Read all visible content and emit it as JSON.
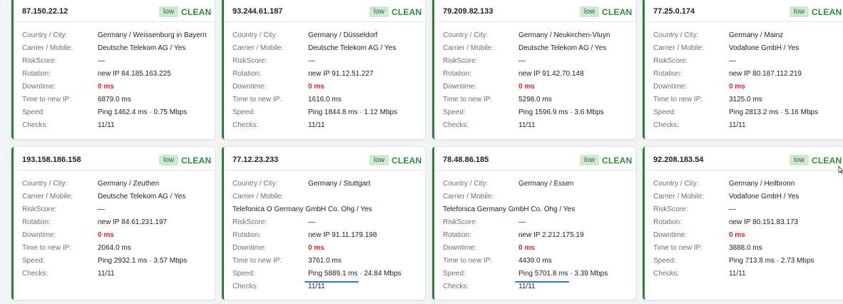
{
  "labels": {
    "country": "Country / City:",
    "carrier": "Carrier / Mobile:",
    "risk": "RiskScore:",
    "rotation": "Rotation:",
    "downtime": "Downtime:",
    "time_new_ip": "Time to new IP:",
    "speed": "Speed:",
    "checks": "Checks:"
  },
  "badge_label": "low",
  "status_label": "CLEAN",
  "colors": {
    "accent": "#2f7d3f",
    "clean": "#2f8a3e",
    "badge_bg": "#cfe8d3",
    "downtime": "#d62828",
    "underline": "#2f73d9"
  },
  "cards": [
    {
      "ip": "87.150.22.12",
      "country": "Germany / Weissenburg in Bayern",
      "carrier": "Deutsche Telekom AG / Yes",
      "risk": "—",
      "rotation": "new IP 84.185.163.225",
      "downtime": "0 ms",
      "time_new_ip": "6879.0 ms",
      "speed": "Ping 1462.4 ms · 0.75 Mbps",
      "checks": "11/11"
    },
    {
      "ip": "93.244.61.187",
      "country": "Germany / Düsseldorf",
      "carrier": "Deutsche Telekom AG / Yes",
      "risk": "—",
      "rotation": "new IP 91.12.51.227",
      "downtime": "0 ms",
      "time_new_ip": "1616.0 ms",
      "speed": "Ping 1844.8 ms · 1.12 Mbps",
      "checks": "11/11"
    },
    {
      "ip": "79.209.82.133",
      "country": "Germany / Neukirchen-Vluyn",
      "carrier": "Deutsche Telekom AG / Yes",
      "risk": "—",
      "rotation": "new IP 91.42.70.148",
      "downtime": "0 ms",
      "time_new_ip": "5298.0 ms",
      "speed": "Ping 1596.9 ms · 3.6 Mbps",
      "checks": "11/11"
    },
    {
      "ip": "77.25.0.174",
      "country": "Germany / Mainz",
      "carrier": "Vodafone GmbH / Yes",
      "risk": "—",
      "rotation": "new IP 80.187.112.219",
      "downtime": "0 ms",
      "time_new_ip": "3125.0 ms",
      "speed": "Ping 2813.2 ms · 5.16 Mbps",
      "checks": "11/11"
    },
    {
      "ip": "193.158.186.158",
      "country": "Germany / Zeuthen",
      "carrier": "Deutsche Telekom AG / Yes",
      "risk": "—",
      "rotation": "new IP 84.61.231.197",
      "downtime": "0 ms",
      "time_new_ip": "2064.0 ms",
      "speed": "Ping 2932.1 ms · 3.57 Mbps",
      "checks": "11/11"
    },
    {
      "ip": "77.12.23.233",
      "country": "Germany / Stuttgart",
      "carrier": "Telefonica O Germany GmbH Co. Ohg / Yes",
      "risk": "—",
      "rotation": "new IP 91.11.179.198",
      "downtime": "0 ms",
      "time_new_ip": "3761.0 ms",
      "speed": "Ping 5889.1 ms · 24.84 Mbps",
      "checks": "11/11"
    },
    {
      "ip": "78.48.86.185",
      "country": "Germany / Essen",
      "carrier": "Telefonica Germany GmbH Co. Ohg / Yes",
      "risk": "—",
      "rotation": "new IP 2.212.175.19",
      "downtime": "0 ms",
      "time_new_ip": "4439.0 ms",
      "speed": "Ping 5701.8 ms · 3.39 Mbps",
      "checks": "11/11"
    },
    {
      "ip": "92.208.183.54",
      "country": "Germany / Heilbronn",
      "carrier": "Vodafone GmbH / Yes",
      "risk": "—",
      "rotation": "new IP 80.151.83.173",
      "downtime": "0 ms",
      "time_new_ip": "3888.0 ms",
      "speed": "Ping 713.8 ms · 2.73 Mbps",
      "checks": "11/11"
    }
  ]
}
